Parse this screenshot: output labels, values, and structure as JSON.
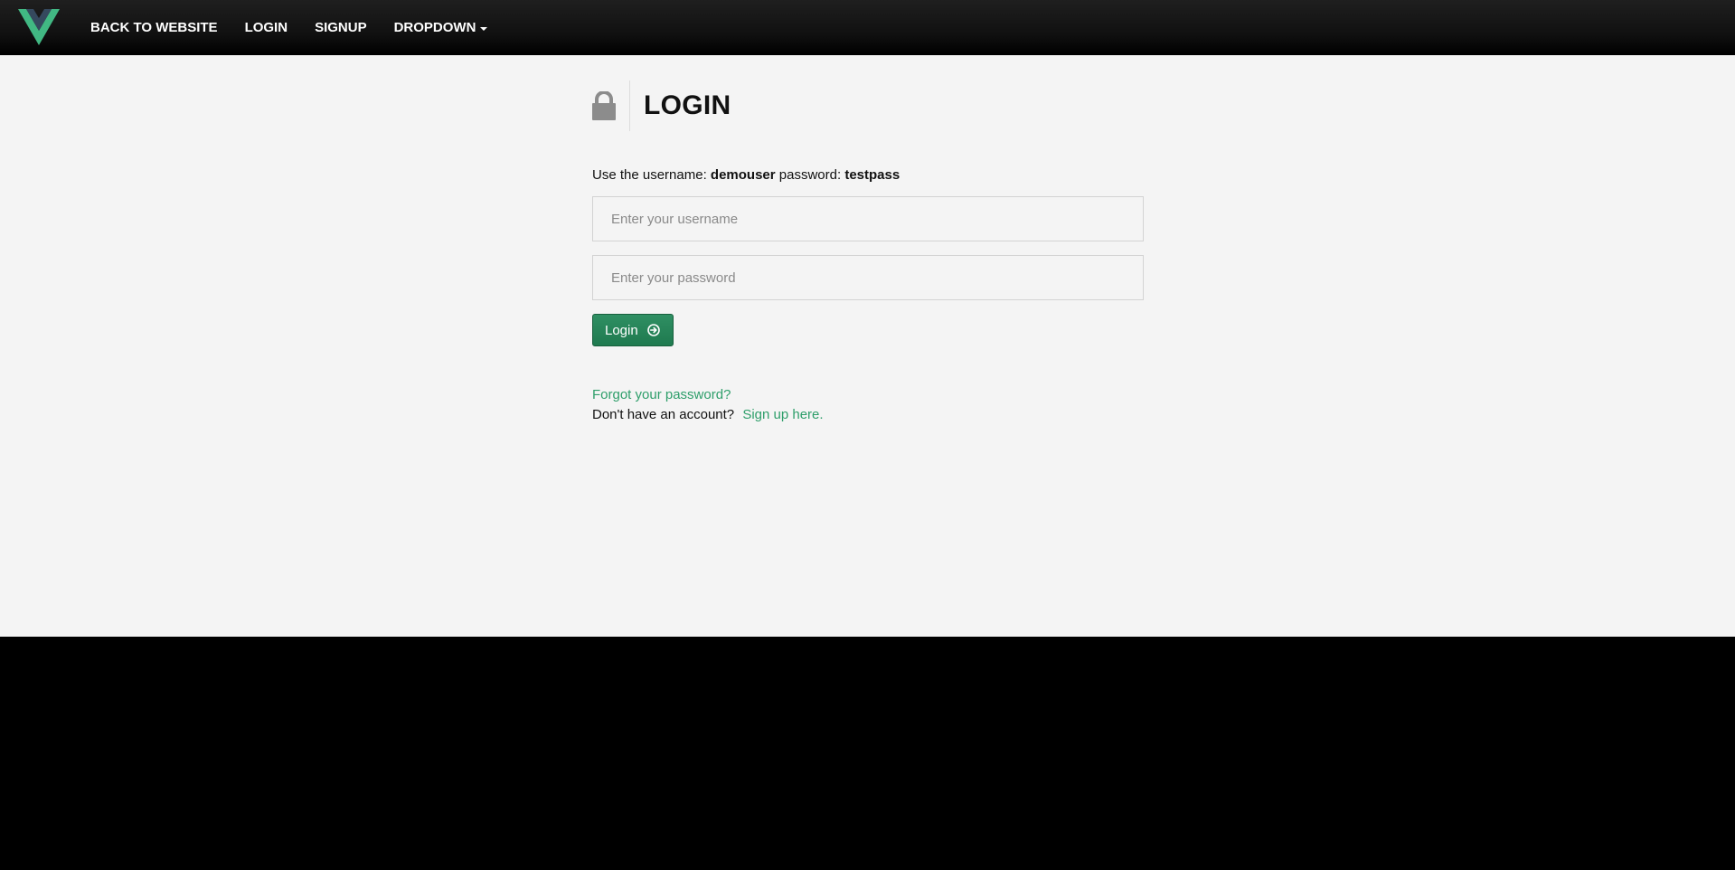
{
  "navbar": {
    "logo": "vue-logo",
    "links": [
      {
        "label": "BACK TO WEBSITE"
      },
      {
        "label": "LOGIN"
      },
      {
        "label": "SIGNUP"
      },
      {
        "label": "DROPDOWN"
      }
    ]
  },
  "header": {
    "icon": "lock-icon",
    "title": "LOGIN"
  },
  "hint": {
    "prefix": "Use the username:",
    "username": "demouser",
    "middle": "password:",
    "password": "testpass"
  },
  "form": {
    "username_placeholder": "Enter your username",
    "username_value": "",
    "password_placeholder": "Enter your password",
    "password_value": "",
    "login_label": "Login"
  },
  "links": {
    "forgot": "Forgot your password?",
    "no_account": "Don't have an account?",
    "signup": "Sign up here."
  },
  "colors": {
    "accent": "#2e9e6a",
    "button": "#1f7a4f",
    "content_bg": "#f4f4f4",
    "navbar_bg": "#111111"
  }
}
